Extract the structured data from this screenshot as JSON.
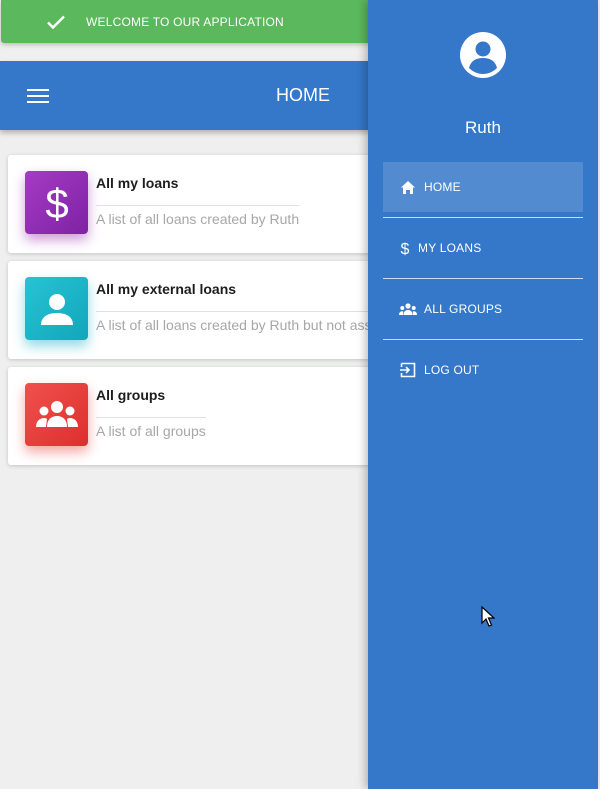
{
  "snackbar": {
    "icon": "check-icon",
    "message": "WELCOME TO OUR APPLICATION",
    "color": "#5cb85c"
  },
  "appbar": {
    "menu_icon": "menu-icon",
    "title": "HOME",
    "color": "#3577c8"
  },
  "cards": [
    {
      "icon": "dollar-icon",
      "title": "All my loans",
      "description": "A list of all loans created by Ruth",
      "accent": "#8e24aa"
    },
    {
      "icon": "person-icon",
      "title": "All my external loans",
      "description": "A list of all loans created by Ruth but not assigned to a group",
      "accent": "#00acc1"
    },
    {
      "icon": "groups-icon",
      "title": "All groups",
      "description": "A list of all groups",
      "accent": "#e53935"
    }
  ],
  "drawer": {
    "avatar_icon": "account-circle-icon",
    "user_name": "Ruth",
    "color": "#3577c8",
    "items": [
      {
        "icon": "home-icon",
        "label": "HOME",
        "active": true
      },
      {
        "icon": "dollar-icon",
        "label": "MY LOANS",
        "active": false
      },
      {
        "icon": "groups-icon",
        "label": "ALL GROUPS",
        "active": false
      },
      {
        "icon": "logout-icon",
        "label": "LOG OUT",
        "active": false
      }
    ]
  }
}
